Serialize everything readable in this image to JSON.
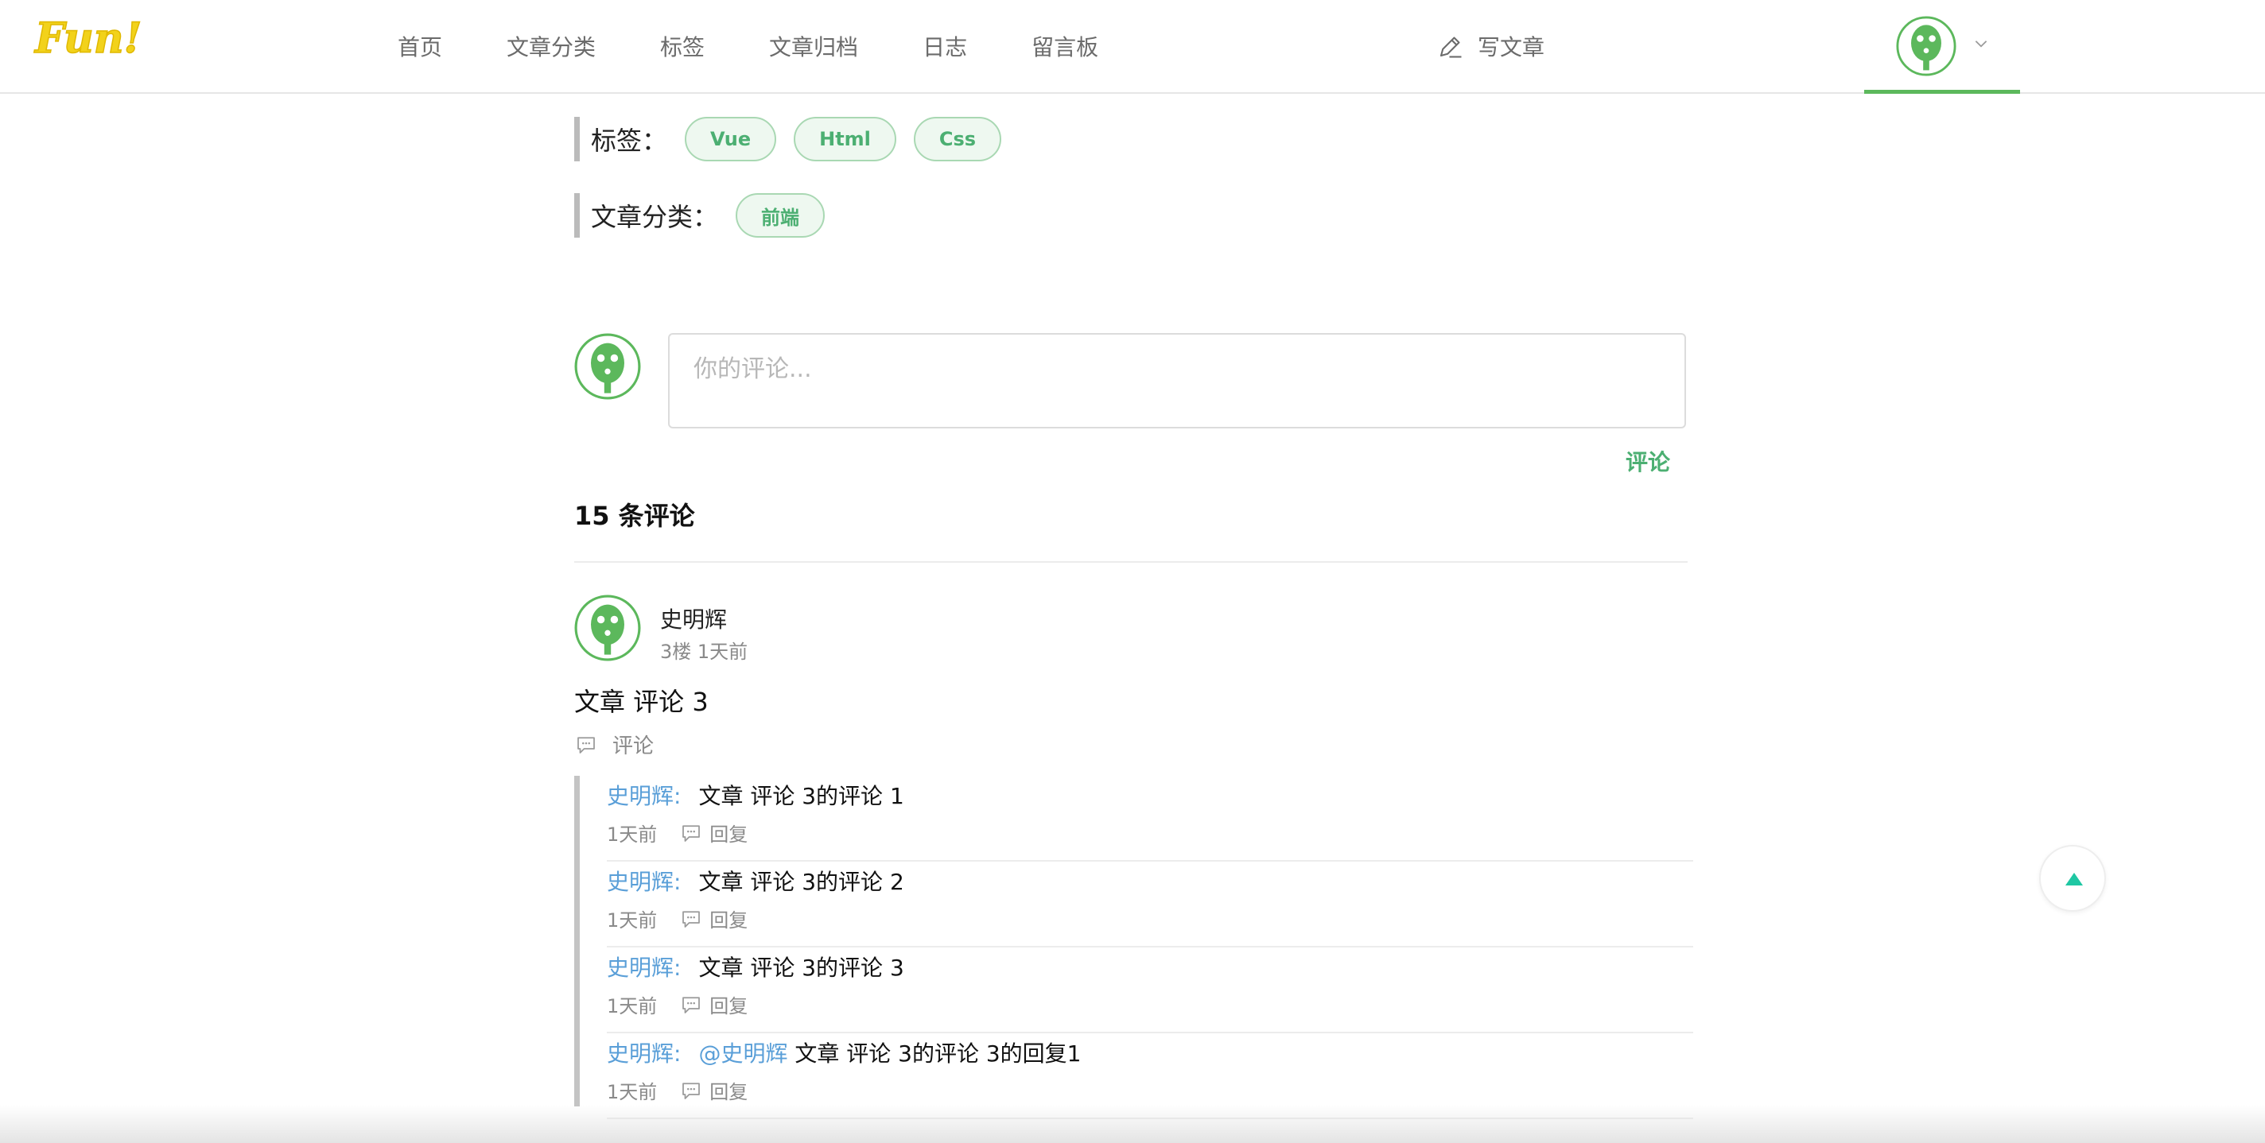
{
  "logo_text": "Fun!",
  "nav": {
    "items": [
      "首页",
      "文章分类",
      "标签",
      "文章归档",
      "日志",
      "留言板"
    ],
    "write_label": "写文章"
  },
  "article_meta": {
    "tags_label": "标签：",
    "tags": [
      "Vue",
      "Html",
      "Css"
    ],
    "category_label": "文章分类：",
    "categories": [
      "前端"
    ]
  },
  "editor": {
    "placeholder": "你的评论...",
    "submit_label": "评论"
  },
  "comments": {
    "count_title": "15 条评论",
    "item": {
      "author": "史明辉",
      "floor_time": "3楼 1天前",
      "text": "文章 评论 3",
      "reply_label": "评论",
      "replies": [
        {
          "author": "史明辉:",
          "at": "",
          "text": "文章 评论 3的评论 1",
          "time": "1天前",
          "reply_label": "回复"
        },
        {
          "author": "史明辉:",
          "at": "",
          "text": "文章 评论 3的评论 2",
          "time": "1天前",
          "reply_label": "回复"
        },
        {
          "author": "史明辉:",
          "at": "",
          "text": "文章 评论 3的评论 3",
          "time": "1天前",
          "reply_label": "回复"
        },
        {
          "author": "史明辉:",
          "at": "@史明辉",
          "text": " 文章 评论 3的评论 3的回复1",
          "time": "1天前",
          "reply_label": "回复"
        }
      ]
    }
  },
  "colors": {
    "accent_green": "#4caf72",
    "link_blue": "#5a9fd8",
    "back_top_arrow": "#1fc7a3",
    "logo_yellow": "#f2d21b"
  },
  "icons": {
    "write": "pencil-icon",
    "avatar": "green-robot-avatar",
    "comment": "speech-bubble-icon",
    "back_top": "triangle-up-icon"
  }
}
